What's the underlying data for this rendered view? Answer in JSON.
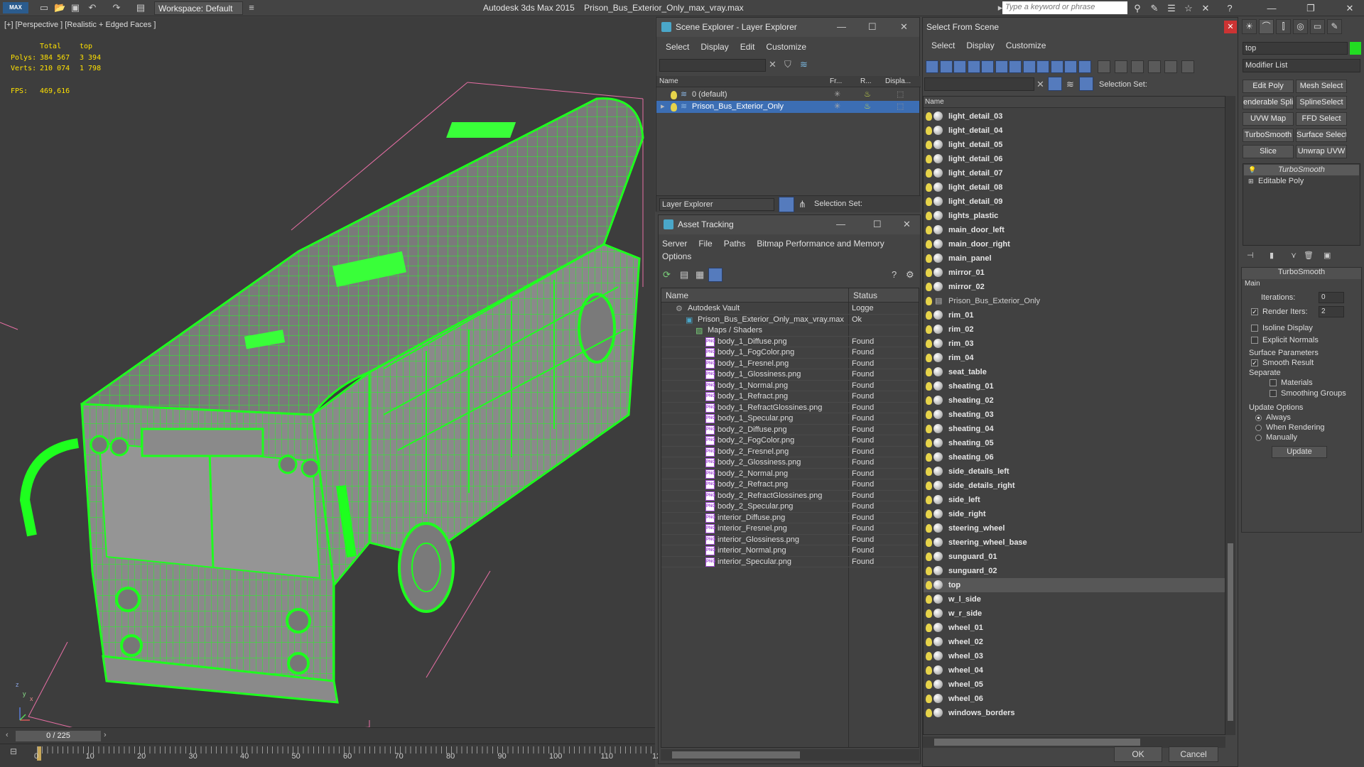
{
  "titlebar": {
    "app": "Autodesk 3ds Max  2015",
    "file": "Prison_Bus_Exterior_Only_max_vray.max",
    "logo": "MAX",
    "workspace": "Workspace: Default",
    "search_placeholder": "Type a keyword or phrase"
  },
  "viewport": {
    "label": "[+] [Perspective ] [Realistic + Edged Faces ]",
    "stats_header_total": "Total",
    "stats_header_sel": "top",
    "polys_label": "Polys:",
    "polys_total": "384 567",
    "polys_sel": "3 394",
    "verts_label": "Verts:",
    "verts_total": "210 074",
    "verts_sel": "1 798",
    "fps_label": "FPS:",
    "fps_value": "469,616",
    "axis_x": "x",
    "axis_y": "y",
    "axis_z": "z"
  },
  "timeline": {
    "frame_counter": "0 / 225",
    "ticks": [
      "0",
      "10",
      "20",
      "30",
      "40",
      "50",
      "60",
      "70",
      "80",
      "90",
      "100",
      "110",
      "12"
    ]
  },
  "layer_explorer": {
    "title": "Scene Explorer - Layer Explorer",
    "menus": [
      "Select",
      "Display",
      "Edit",
      "Customize"
    ],
    "col_name": "Name",
    "col_frozen": "Fr...",
    "col_render": "R...",
    "col_display": "Displa...",
    "layers": [
      {
        "name": "0 (default)",
        "selected": false
      },
      {
        "name": "Prison_Bus_Exterior_Only",
        "selected": true
      }
    ],
    "footer_mode": "Layer Explorer",
    "footer_selset": "Selection Set:"
  },
  "asset_tracking": {
    "title": "Asset Tracking",
    "menus": [
      "Server",
      "File",
      "Paths",
      "Bitmap Performance and Memory"
    ],
    "menu_options": "Options",
    "col_name": "Name",
    "col_status": "Status",
    "rows": [
      {
        "name": "Autodesk Vault",
        "status": "Logge",
        "indent": 0,
        "type": "vault"
      },
      {
        "name": "Prison_Bus_Exterior_Only_max_vray.max",
        "status": "Ok",
        "indent": 1,
        "type": "max"
      },
      {
        "name": "Maps / Shaders",
        "status": "",
        "indent": 2,
        "type": "maps"
      },
      {
        "name": "body_1_Diffuse.png",
        "status": "Found",
        "indent": 3,
        "type": "png"
      },
      {
        "name": "body_1_FogColor.png",
        "status": "Found",
        "indent": 3,
        "type": "png"
      },
      {
        "name": "body_1_Fresnel.png",
        "status": "Found",
        "indent": 3,
        "type": "png"
      },
      {
        "name": "body_1_Glossiness.png",
        "status": "Found",
        "indent": 3,
        "type": "png"
      },
      {
        "name": "body_1_Normal.png",
        "status": "Found",
        "indent": 3,
        "type": "png"
      },
      {
        "name": "body_1_Refract.png",
        "status": "Found",
        "indent": 3,
        "type": "png"
      },
      {
        "name": "body_1_RefractGlossines.png",
        "status": "Found",
        "indent": 3,
        "type": "png"
      },
      {
        "name": "body_1_Specular.png",
        "status": "Found",
        "indent": 3,
        "type": "png"
      },
      {
        "name": "body_2_Diffuse.png",
        "status": "Found",
        "indent": 3,
        "type": "png"
      },
      {
        "name": "body_2_FogColor.png",
        "status": "Found",
        "indent": 3,
        "type": "png"
      },
      {
        "name": "body_2_Fresnel.png",
        "status": "Found",
        "indent": 3,
        "type": "png"
      },
      {
        "name": "body_2_Glossiness.png",
        "status": "Found",
        "indent": 3,
        "type": "png"
      },
      {
        "name": "body_2_Normal.png",
        "status": "Found",
        "indent": 3,
        "type": "png"
      },
      {
        "name": "body_2_Refract.png",
        "status": "Found",
        "indent": 3,
        "type": "png"
      },
      {
        "name": "body_2_RefractGlossines.png",
        "status": "Found",
        "indent": 3,
        "type": "png"
      },
      {
        "name": "body_2_Specular.png",
        "status": "Found",
        "indent": 3,
        "type": "png"
      },
      {
        "name": "interior_Diffuse.png",
        "status": "Found",
        "indent": 3,
        "type": "png"
      },
      {
        "name": "interior_Fresnel.png",
        "status": "Found",
        "indent": 3,
        "type": "png"
      },
      {
        "name": "interior_Glossiness.png",
        "status": "Found",
        "indent": 3,
        "type": "png"
      },
      {
        "name": "interior_Normal.png",
        "status": "Found",
        "indent": 3,
        "type": "png"
      },
      {
        "name": "interior_Specular.png",
        "status": "Found",
        "indent": 3,
        "type": "png"
      }
    ]
  },
  "select_from_scene": {
    "title": "Select From Scene",
    "menus": [
      "Select",
      "Display",
      "Customize"
    ],
    "selset_label": "Selection Set:",
    "col_name": "Name",
    "ok": "OK",
    "cancel": "Cancel",
    "items": [
      "light_detail_03",
      "light_detail_04",
      "light_detail_05",
      "light_detail_06",
      "light_detail_07",
      "light_detail_08",
      "light_detail_09",
      "lights_plastic",
      "main_door_left",
      "main_door_right",
      "main_panel",
      "mirror_01",
      "mirror_02",
      "Prison_Bus_Exterior_Only",
      "rim_01",
      "rim_02",
      "rim_03",
      "rim_04",
      "seat_table",
      "sheating_01",
      "sheating_02",
      "sheating_03",
      "sheating_04",
      "sheating_05",
      "sheating_06",
      "side_details_left",
      "side_details_right",
      "side_left",
      "side_right",
      "steering_wheel",
      "steering_wheel_base",
      "sunguard_01",
      "sunguard_02",
      "top",
      "w_l_side",
      "w_r_side",
      "wheel_01",
      "wheel_02",
      "wheel_03",
      "wheel_04",
      "wheel_05",
      "wheel_06",
      "windows_borders"
    ],
    "selected_item": "top",
    "layer_item": "Prison_Bus_Exterior_Only"
  },
  "command_panel": {
    "object_name": "top",
    "object_color": "#22dd22",
    "modifier_list": "Modifier List",
    "buttons": [
      "Edit Poly",
      "Mesh Select",
      "enderable Splir",
      "SplineSelect",
      "UVW Map",
      "FFD Select",
      "TurboSmooth",
      "Surface Select",
      "Slice",
      "Unwrap UVW"
    ],
    "stack": [
      {
        "name": "TurboSmooth",
        "active": true
      },
      {
        "name": "Editable Poly",
        "active": false
      }
    ],
    "rollout_title": "TurboSmooth",
    "main_group": "Main",
    "iterations_label": "Iterations:",
    "iterations_value": "0",
    "render_iters_label": "Render Iters:",
    "render_iters_value": "2",
    "render_iters_checked": true,
    "isoline": "Isoline Display",
    "explicit": "Explicit Normals",
    "surface_group": "Surface Parameters",
    "smooth_result": "Smooth Result",
    "separate": "Separate",
    "materials": "Materials",
    "smoothing_groups": "Smoothing Groups",
    "update_group": "Update Options",
    "always": "Always",
    "when_rendering": "When Rendering",
    "manually": "Manually",
    "update_button": "Update"
  }
}
